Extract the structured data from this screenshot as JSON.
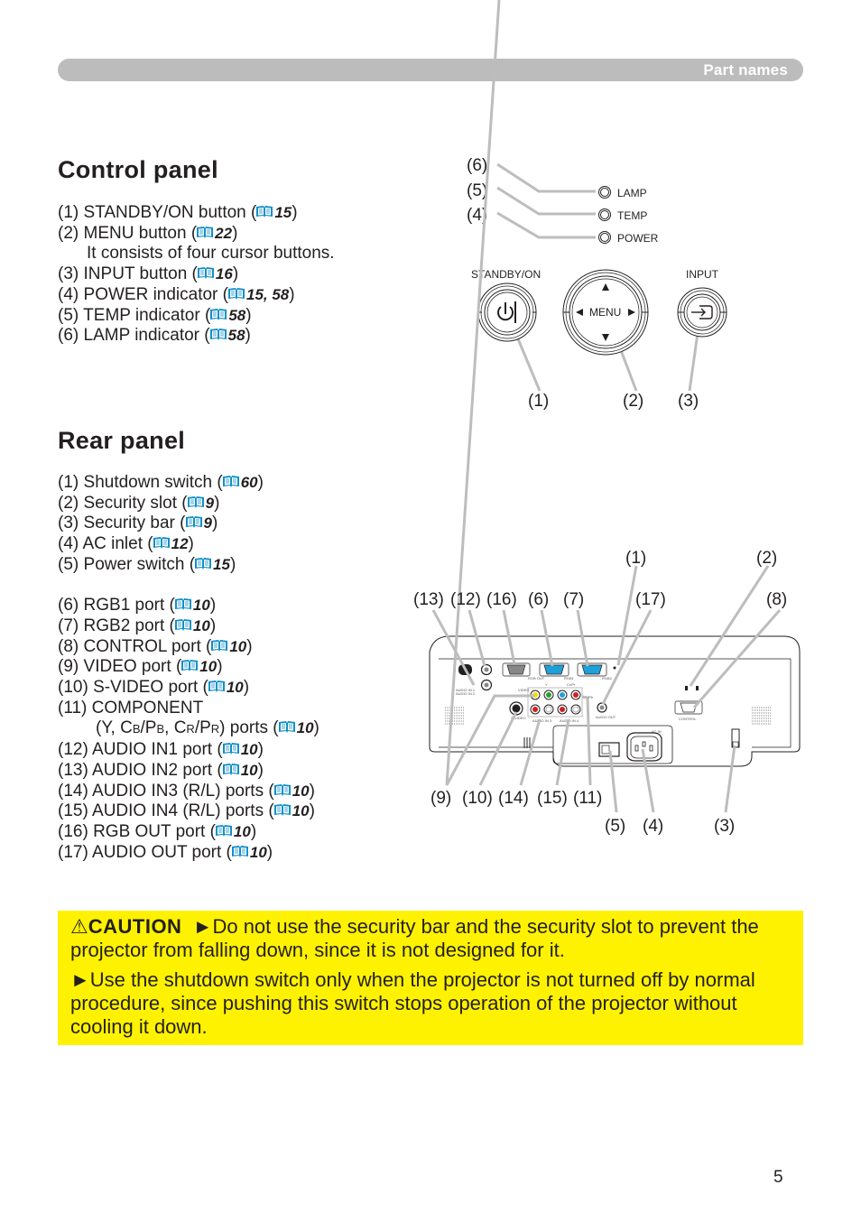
{
  "header": {
    "section": "Part names"
  },
  "control_panel": {
    "title": "Control panel",
    "items": [
      {
        "num": "(1)",
        "text": "STANDBY/ON button (",
        "ref": "15",
        "close": ")"
      },
      {
        "num": "(2)",
        "text": "MENU button (",
        "ref": "22",
        "close": ")"
      },
      {
        "num": "",
        "text": "It consists of four cursor buttons.",
        "ref": "",
        "close": ""
      },
      {
        "num": "(3)",
        "text": "INPUT button (",
        "ref": "16",
        "close": ")"
      },
      {
        "num": "(4)",
        "text": "POWER indicator (",
        "ref": "15, 58",
        "close": ")"
      },
      {
        "num": "(5)",
        "text": "TEMP indicator (",
        "ref": "58",
        "close": ")"
      },
      {
        "num": "(6)",
        "text": "LAMP indicator (",
        "ref": "58",
        "close": ")"
      }
    ],
    "diagram": {
      "indicators": [
        "LAMP",
        "TEMP",
        "POWER"
      ],
      "buttons": {
        "standby": "STANDBY/ON",
        "menu": "MENU",
        "input": "INPUT"
      },
      "callouts": {
        "c1": "(1)",
        "c2": "(2)",
        "c3": "(3)",
        "c4": "(4)",
        "c5": "(5)",
        "c6": "(6)"
      }
    }
  },
  "rear_panel": {
    "title": "Rear panel",
    "items_a": [
      {
        "num": "(1)",
        "text": "Shutdown switch (",
        "ref": "60",
        "close": ")"
      },
      {
        "num": "(2)",
        "text": "Security slot (",
        "ref": "9",
        "close": ")"
      },
      {
        "num": "(3)",
        "text": "Security bar (",
        "ref": "9",
        "close": ")"
      },
      {
        "num": "(4)",
        "text": "AC inlet (",
        "ref": "12",
        "close": ")"
      },
      {
        "num": "(5)",
        "text": "Power switch (",
        "ref": "15",
        "close": ")"
      }
    ],
    "items_b": [
      {
        "num": "(6)",
        "text": "RGB1 port (",
        "ref": "10",
        "close": ")"
      },
      {
        "num": "(7)",
        "text": "RGB2 port (",
        "ref": "10",
        "close": ")"
      },
      {
        "num": "(8)",
        "text": "CONTROL port (",
        "ref": "10",
        "close": ")"
      },
      {
        "num": "(9)",
        "text": "VIDEO port (",
        "ref": "10",
        "close": ")"
      },
      {
        "num": "(10)",
        "text": "S-VIDEO port (",
        "ref": "10",
        "close": ")"
      },
      {
        "num": "(11)",
        "text": "COMPONENT",
        "ref": "",
        "close": ""
      }
    ],
    "component_line": {
      "pre": "(Y, C",
      "b1": "B",
      "mid1": "/P",
      "b2": "B",
      "mid2": ", C",
      "r1": "R",
      "mid3": "/P",
      "r2": "R",
      "post": ") ports (",
      "ref": "10",
      "close": ")"
    },
    "items_c": [
      {
        "num": "(12)",
        "text": "AUDIO IN1 port (",
        "ref": "10",
        "close": ")"
      },
      {
        "num": "(13)",
        "text": "AUDIO IN2 port (",
        "ref": "10",
        "close": ")"
      },
      {
        "num": "(14)",
        "text": "AUDIO IN3 (R/L) ports (",
        "ref": "10",
        "close": ")"
      },
      {
        "num": "(15)",
        "text": "AUDIO IN4 (R/L) ports (",
        "ref": "10",
        "close": ")"
      },
      {
        "num": "(16)",
        "text": "RGB OUT port (",
        "ref": "10",
        "close": ")"
      },
      {
        "num": "(17)",
        "text": "AUDIO OUT port (",
        "ref": "10",
        "close": ")"
      }
    ],
    "diagram": {
      "top_callouts": [
        "(13)",
        "(12)",
        "(16)",
        "(6)",
        "(7)",
        "(17)",
        "(8)"
      ],
      "upper_callouts": [
        "(1)",
        "(2)"
      ],
      "bottom_callouts": [
        "(9)",
        "(10)",
        "(14)",
        "(15)",
        "(11)"
      ],
      "lower_callouts": [
        "(5)",
        "(4)",
        "(3)"
      ],
      "port_labels": {
        "audio_in1": "AUDIO IN 1",
        "audio_in2": "AUDIO IN 2",
        "rgb_out": "RGB OUT",
        "rgb1": "RGB1",
        "rgb2": "RGB2",
        "video": "VIDEO",
        "svideo": "S-VIDEO",
        "audio_out": "AUDIO OUT",
        "control": "CONTROL",
        "ac_in": "AC IN",
        "audio_in3": "AUDIO IN 3",
        "audio_in4": "AUDIO IN 4",
        "y": "Y",
        "cbpb": "Cb/Pb",
        "crpr": "Cr/Pr",
        "r": "R",
        "l": "L",
        "lock_l": "L",
        "lock_r": "R"
      }
    }
  },
  "caution": {
    "label": "CAUTION",
    "para1": "►Do not use the security bar and the security slot to prevent the projector from falling down, since it is not designed for it.",
    "para2": "►Use the shutdown switch only when the projector is not turned off by normal procedure, since pushing this switch stops operation of the projector without cooling it down."
  },
  "page_number": "5",
  "colors": {
    "header_bar": "#bcbcbc",
    "caution_bg": "#fff200",
    "book_icon": "#0f8fc8",
    "rgb_port": "#1ea0d8",
    "callout_line": "#bdbdbd"
  }
}
